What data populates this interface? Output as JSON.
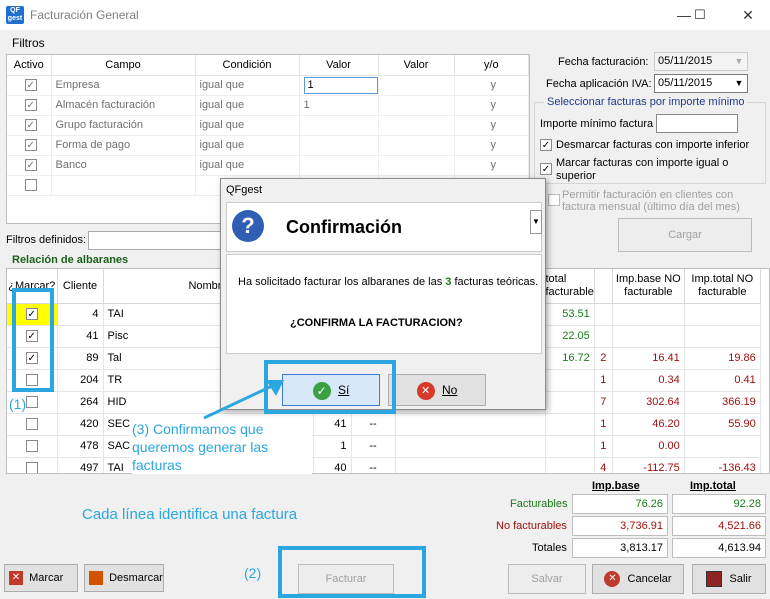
{
  "window": {
    "app_icon": "QF gest",
    "title": "Facturación General",
    "minimize": "—",
    "maximize": "☐",
    "close": "✕"
  },
  "filtros": {
    "label": "Filtros",
    "columns": [
      "Activo",
      "Campo",
      "Condición",
      "Valor",
      "Valor",
      "y/o"
    ],
    "rows": [
      {
        "campo": "Empresa",
        "condicion": "igual que",
        "valor": "1",
        "valor2": "",
        "yo": "y"
      },
      {
        "campo": "Almacén facturación",
        "condicion": "igual que",
        "valor": "1",
        "valor2": "",
        "yo": "y"
      },
      {
        "campo": "Grupo facturación",
        "condicion": "igual que",
        "valor": "",
        "valor2": "",
        "yo": "y"
      },
      {
        "campo": "Forma de pago",
        "condicion": "igual que",
        "valor": "",
        "valor2": "",
        "yo": "y"
      },
      {
        "campo": "Banco",
        "condicion": "igual que",
        "valor": "",
        "valor2": "",
        "yo": "y"
      }
    ],
    "check": "✓",
    "definidos_label": "Filtros definidos:"
  },
  "right_panel": {
    "fecha_facturacion_label": "Fecha facturación:",
    "fecha_facturacion": "05/11/2015",
    "fecha_iva_label": "Fecha aplicación IVA:",
    "fecha_iva": "05/11/2015",
    "group_title": "Seleccionar facturas por importe mínimo",
    "importe_label": "Importe mínimo factura",
    "desmarcar_label": "Desmarcar facturas con importe inferior",
    "marcar_label": "Marcar facturas con importe igual o superior",
    "permitir_label": "Permitir facturación en clientes con factura mensual (último día del mes)",
    "cargar": "Cargar",
    "arrow": "▼"
  },
  "relacion": {
    "title": "Relación de albaranes",
    "columns": [
      "¿Marcar?",
      "Cliente",
      "Nombre",
      "",
      "",
      "",
      "total facturable",
      "",
      "Imp.base NO facturable",
      "Imp.total NO facturable"
    ],
    "rows": [
      {
        "checked": true,
        "cliente": "4",
        "nombre": "TAI",
        "a": "",
        "b": "",
        "total": "53.51",
        "n": "",
        "base_no": "",
        "total_no": ""
      },
      {
        "checked": true,
        "cliente": "41",
        "nombre": "Pisc",
        "a": "",
        "b": "",
        "total": "22.05",
        "n": "",
        "base_no": "",
        "total_no": ""
      },
      {
        "checked": true,
        "cliente": "89",
        "nombre": "Tal",
        "a": "",
        "b": "",
        "total": "16.72",
        "n": "2",
        "base_no": "16.41",
        "total_no": "19.86"
      },
      {
        "checked": false,
        "cliente": "204",
        "nombre": "TR",
        "a": "",
        "b": "",
        "total": "",
        "n": "1",
        "base_no": "0.34",
        "total_no": "0.41"
      },
      {
        "checked": false,
        "cliente": "264",
        "nombre": "HID",
        "a": "",
        "b": "",
        "total": "",
        "n": "7",
        "base_no": "302.64",
        "total_no": "366.19"
      },
      {
        "checked": false,
        "cliente": "420",
        "nombre": "SEC",
        "a": "41",
        "b": "--",
        "total": "",
        "n": "1",
        "base_no": "46.20",
        "total_no": "55.90"
      },
      {
        "checked": false,
        "cliente": "478",
        "nombre": "SAC",
        "a": "1",
        "b": "--",
        "total": "",
        "n": "1",
        "base_no": "0.00",
        "total_no": ""
      },
      {
        "checked": false,
        "cliente": "497",
        "nombre": "TAI",
        "a": "40",
        "b": "--",
        "total": "",
        "n": "4",
        "base_no": "-112.75",
        "total_no": "-136.43"
      }
    ]
  },
  "totals": {
    "imp_base_h": "Imp.base",
    "imp_total_h": "Imp.total",
    "facturables_label": "Facturables",
    "facturables_base": "76.26",
    "facturables_total": "92.28",
    "no_facturables_label": "No facturables",
    "no_facturables_base": "3,736.91",
    "no_facturables_total": "4,521.66",
    "totales_label": "Totales",
    "totales_base": "3,813.17",
    "totales_total": "4,613.94"
  },
  "bottom_buttons": {
    "marcar": "Marcar",
    "desmarcar": "Desmarcar",
    "facturar": "Facturar",
    "salvar": "Salvar",
    "cancelar": "Cancelar",
    "salir": "Salir"
  },
  "dialog": {
    "title": "QFgest",
    "heading": "Confirmación",
    "message_pre": "Ha solicitado facturar los albaranes de las ",
    "message_count": "3",
    "message_post": " facturas teóricas.",
    "question": "¿CONFIRMA LA FACTURACION?",
    "yes": "Sí",
    "no": "No",
    "question_icon": "?",
    "yes_icon": "✓",
    "no_icon": "✕"
  },
  "annotations": {
    "one": "(1)",
    "two": "(2)",
    "three": "(3)  Confirmamos que queremos generar las facturas",
    "cada_linea": "Cada línea identifica una factura"
  },
  "colors": {
    "annotation": "#2aa7e0",
    "highlight": "#ffff00",
    "dialog_icon": "#2f5fb5"
  }
}
